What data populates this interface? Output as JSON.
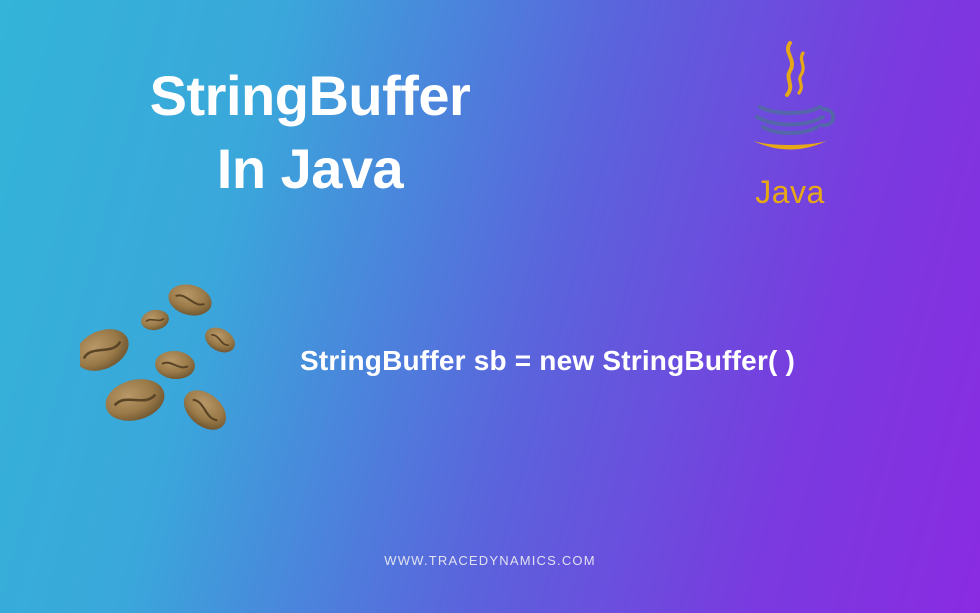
{
  "title_line1": "StringBuffer",
  "title_line2": "In Java",
  "code_snippet": "StringBuffer sb = new StringBuffer( )",
  "logo_label": "Java",
  "footer_text": "WWW.TRACEDYNAMICS.COM",
  "colors": {
    "gradient_start": "#33b4d8",
    "gradient_end": "#8a2be2",
    "logo_accent": "#e6a817",
    "text": "#ffffff",
    "bean_fill": "#a1814f"
  }
}
